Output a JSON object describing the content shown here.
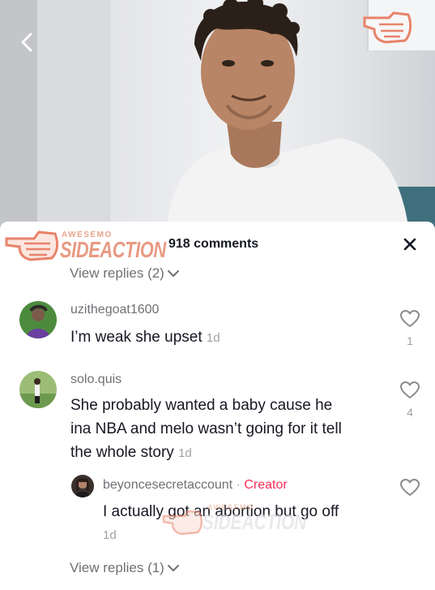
{
  "header": {
    "comment_count": "918 comments"
  },
  "watermark": {
    "small": "AWESEMO",
    "big": "SIDEACTION"
  },
  "view_replies_top": "View replies (2)",
  "view_replies_bottom": "View replies (1)",
  "comments": [
    {
      "username": "uzithegoat1600",
      "text": "I’m weak she upset",
      "time": "1d",
      "likes": "1"
    },
    {
      "username": "solo.quis",
      "text_lines": [
        "She probably wanted a baby cause he",
        "ina NBA and melo wasn’t going for it tell",
        "the whole story"
      ],
      "time": "1d",
      "likes": "4"
    }
  ],
  "reply": {
    "username": "beyoncesecretaccount",
    "separator": "·",
    "badge": "Creator",
    "text": "I actually got an abortion but go off",
    "time": "1d"
  },
  "colors": {
    "creator": "#fe2c55",
    "watermark": "#e89a84",
    "muted": "#6f7075"
  },
  "icons": {
    "back": "chevron-left-icon",
    "close": "close-icon",
    "like": "heart-outline-icon",
    "expand": "chevron-down-icon"
  }
}
